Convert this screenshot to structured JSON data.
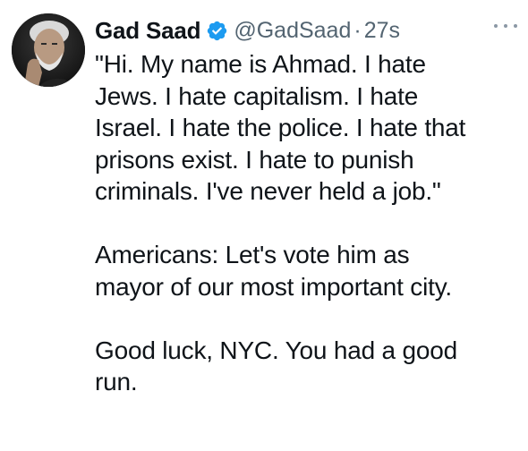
{
  "tweet": {
    "display_name": "Gad Saad",
    "handle": "@GadSaad",
    "separator": "·",
    "timestamp": "27s",
    "verified_icon": "verified-badge-icon",
    "more_icon": "more-options-icon",
    "avatar": "user-avatar",
    "paragraphs": [
      {
        "lines": [
          "\"Hi.  My name is Ahmad.  I hate",
          "Jews.  I hate capitalism.  I hate",
          "Israel.  I hate the police.  I hate that",
          "prisons exist.  I hate to punish",
          "criminals.  I've never held a job.\""
        ]
      },
      {
        "lines": [
          "Americans:  Let's vote him as",
          "mayor of our most important city."
        ]
      },
      {
        "lines": [
          "Good luck, NYC.  You had a good",
          "run."
        ]
      }
    ]
  },
  "colors": {
    "text": "#0f1419",
    "secondary": "#536471",
    "verified_blue": "#1d9bf0"
  }
}
